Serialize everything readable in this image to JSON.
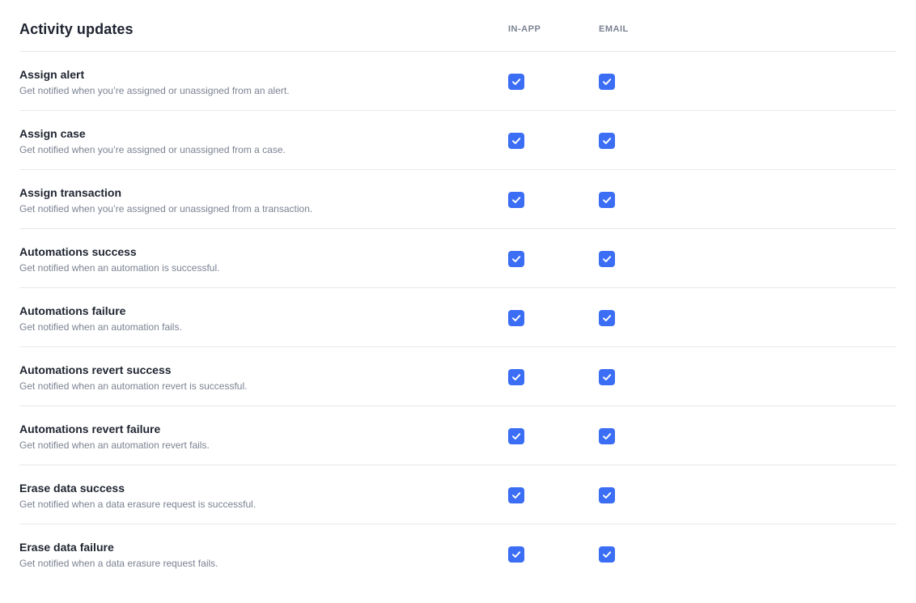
{
  "section": {
    "title": "Activity updates",
    "columns": [
      "IN-APP",
      "EMAIL"
    ]
  },
  "colors": {
    "accent": "#3b6ef5",
    "divider": "#e6e8ec",
    "muted_text": "#7b8291"
  },
  "rows": [
    {
      "name": "Assign alert",
      "description": "Get notified when you’re assigned or unassigned from an alert.",
      "in_app": true,
      "email": true
    },
    {
      "name": "Assign case",
      "description": "Get notified when you’re assigned or unassigned from a case.",
      "in_app": true,
      "email": true
    },
    {
      "name": "Assign transaction",
      "description": "Get notified when you’re assigned or unassigned from a transaction.",
      "in_app": true,
      "email": true
    },
    {
      "name": "Automations success",
      "description": "Get notified when an automation is successful.",
      "in_app": true,
      "email": true
    },
    {
      "name": "Automations failure",
      "description": "Get notified when an automation fails.",
      "in_app": true,
      "email": true
    },
    {
      "name": "Automations revert success",
      "description": "Get notified when an automation revert is successful.",
      "in_app": true,
      "email": true
    },
    {
      "name": "Automations revert failure",
      "description": "Get notified when an automation revert fails.",
      "in_app": true,
      "email": true
    },
    {
      "name": "Erase data success",
      "description": "Get notified when a data erasure request is successful.",
      "in_app": true,
      "email": true
    },
    {
      "name": "Erase data failure",
      "description": "Get notified when a data erasure request fails.",
      "in_app": true,
      "email": true
    }
  ]
}
